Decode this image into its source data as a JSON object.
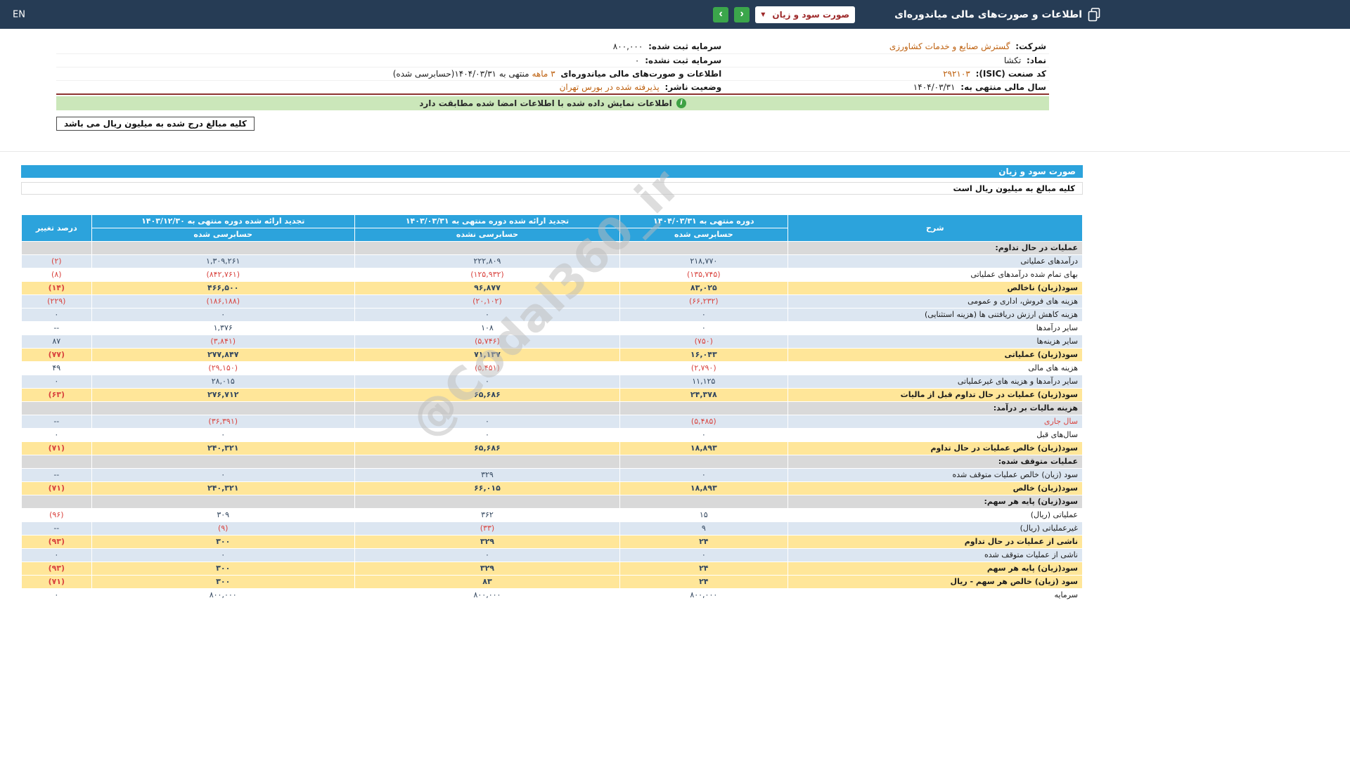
{
  "colors": {
    "topbar_navy": "#263C55",
    "accent_blue": "#2CA3DC",
    "row_blue": "#DCE6F1",
    "row_yellow": "#FFE699",
    "row_gray": "#D9D9D9",
    "negative_red": "#D9443F",
    "value_orange": "#BE6110",
    "banner_green": "#CBE7BA",
    "maroon": "#8C3330",
    "button_green": "#3BA64B"
  },
  "topbar": {
    "title": "اطلاعات و صورت‌های مالی میاندوره‌ای",
    "report_select_value": "صورت سود و زیان",
    "select_caret": "▼",
    "nav_forward": "‹",
    "nav_back": "›",
    "lang_link": "EN"
  },
  "company": {
    "rows": [
      {
        "r_label": "شرکت:",
        "r_value": "گسترش صنایع و خدمات کشاورزی",
        "r_class": "val orange",
        "l_label": "سرمایه ثبت شده:",
        "l_value": "۸۰۰,۰۰۰",
        "l_class": "val"
      },
      {
        "r_label": "نماد:",
        "r_value": "تکشا",
        "r_class": "val",
        "l_label": "سرمایه ثبت نشده:",
        "l_value": "۰",
        "l_class": "val"
      },
      {
        "r_label": "کد صنعت (ISIC):",
        "r_value": "۲۹۲۱۰۳",
        "r_class": "val orange",
        "l_label": "اطلاعات و صورت‌های مالی میاندوره‌ای",
        "l_value": "۳ ماهه",
        "l_class": "val orange",
        "l_suffix": "منتهی به ۱۴۰۴/۰۳/۳۱(حسابرسی شده)"
      },
      {
        "r_label": "سال مالی منتهی به:",
        "r_value": "۱۴۰۴/۰۳/۳۱",
        "r_class": "val",
        "l_label": "وضعیت ناشر:",
        "l_value": "پذیرفته شده در بورس تهران",
        "l_class": "val orange"
      }
    ],
    "signed_banner": "اطلاعات نمایش داده شده با اطلاعات امضا شده مطابقت دارد",
    "amounts_note": "کلیه مبالغ درج شده به میلیون ریال می باشد"
  },
  "statement": {
    "title": "صورت سود و زیان",
    "subtitle": "کلیه مبالغ به میلیون ریال است",
    "columns": {
      "desc": "شرح",
      "pct": "درصد تغییر",
      "periods": [
        {
          "title": "دوره منتهی به ۱۴۰۴/۰۳/۳۱",
          "sub": "حسابرسی شده"
        },
        {
          "title": "تجدید ارائه شده دوره منتهی به ۱۴۰۳/۰۳/۳۱",
          "sub": "حسابرسی نشده"
        },
        {
          "title": "تجدید ارائه شده دوره منتهی به ۱۴۰۳/۱۲/۳۰",
          "sub": "حسابرسی شده"
        }
      ]
    },
    "rows": [
      {
        "label": "عملیات در حال تداوم:",
        "bg": "gray"
      },
      {
        "label": "درآمدهای عملیاتی",
        "c1": "۲۱۸,۷۷۰",
        "c2": "۲۲۲,۸۰۹",
        "c3": "۱,۳۰۹,۲۶۱",
        "pct": "(۲)",
        "bg": "blue"
      },
      {
        "label": "بهای تمام شده درآمدهای عملیاتی",
        "c1": "(۱۳۵,۷۴۵)",
        "c2": "(۱۲۵,۹۳۲)",
        "c3": "(۸۴۲,۷۶۱)",
        "pct": "(۸)",
        "bg": "white"
      },
      {
        "label": "سود(زیان) ناخالص",
        "c1": "۸۳,۰۲۵",
        "c2": "۹۶,۸۷۷",
        "c3": "۴۶۶,۵۰۰",
        "pct": "(۱۴)",
        "bg": "yellow"
      },
      {
        "label": "هزینه های فروش، اداری و عمومی",
        "c1": "(۶۶,۲۳۲)",
        "c2": "(۲۰,۱۰۲)",
        "c3": "(۱۸۶,۱۸۸)",
        "pct": "(۲۲۹)",
        "bg": "blue"
      },
      {
        "label": "هزینه کاهش ارزش دریافتنی ها (هزینه استثنایی)",
        "c1": "۰",
        "c2": "۰",
        "c3": "۰",
        "pct": "۰",
        "bg": "blue"
      },
      {
        "label": "سایر درآمدها",
        "c1": "۰",
        "c2": "۱۰۸",
        "c3": "۱,۳۷۶",
        "pct": "--",
        "bg": "white"
      },
      {
        "label": "سایر هزینه‌ها",
        "c1": "(۷۵۰)",
        "c2": "(۵,۷۴۶)",
        "c3": "(۳,۸۴۱)",
        "pct": "۸۷",
        "bg": "blue"
      },
      {
        "label": "سود(زیان) عملیاتی",
        "c1": "۱۶,۰۴۳",
        "c2": "۷۱,۱۳۷",
        "c3": "۲۷۷,۸۴۷",
        "pct": "(۷۷)",
        "bg": "yellow"
      },
      {
        "label": "هزینه های مالی",
        "c1": "(۲,۷۹۰)",
        "c2": "(۵,۴۵۱)",
        "c3": "(۲۹,۱۵۰)",
        "pct": "۴۹",
        "bg": "white"
      },
      {
        "label": "سایر درآمدها و هزینه های غیرعملیاتی",
        "c1": "۱۱,۱۲۵",
        "c2": "۰",
        "c3": "۲۸,۰۱۵",
        "pct": "۰",
        "bg": "blue"
      },
      {
        "label": "سود(زیان) عملیات در حال تداوم قبل از مالیات",
        "c1": "۲۴,۳۷۸",
        "c2": "۶۵,۶۸۶",
        "c3": "۲۷۶,۷۱۲",
        "pct": "(۶۳)",
        "bg": "yellow"
      },
      {
        "label": "هزینه مالیات بر درآمد:",
        "bg": "gray"
      },
      {
        "label": "سال جاری",
        "c1": "(۵,۴۸۵)",
        "c2": "۰",
        "c3": "(۳۶,۳۹۱)",
        "pct": "--",
        "bg": "blue",
        "red": true
      },
      {
        "label": "سال‌های قبل",
        "c1": "۰",
        "c2": "۰",
        "c3": "۰",
        "pct": "۰",
        "bg": "white"
      },
      {
        "label": "سود(زیان) خالص عملیات در حال تداوم",
        "c1": "۱۸,۸۹۳",
        "c2": "۶۵,۶۸۶",
        "c3": "۲۴۰,۳۲۱",
        "pct": "(۷۱)",
        "bg": "yellow"
      },
      {
        "label": "عملیات متوقف شده:",
        "bg": "gray"
      },
      {
        "label": "سود (زیان) خالص عملیات متوقف شده",
        "c1": "۰",
        "c2": "۳۲۹",
        "c3": "۰",
        "pct": "--",
        "bg": "blue"
      },
      {
        "label": "سود(زیان) خالص",
        "c1": "۱۸,۸۹۳",
        "c2": "۶۶,۰۱۵",
        "c3": "۲۴۰,۳۲۱",
        "pct": "(۷۱)",
        "bg": "yellow"
      },
      {
        "label": "سود(زیان) پایه هر سهم:",
        "bg": "gray"
      },
      {
        "label": "عملیاتی (ریال)",
        "c1": "۱۵",
        "c2": "۳۶۲",
        "c3": "۳۰۹",
        "pct": "(۹۶)",
        "bg": "white"
      },
      {
        "label": "غیرعملیاتی (ریال)",
        "c1": "۹",
        "c2": "(۳۳)",
        "c3": "(۹)",
        "pct": "--",
        "bg": "blue"
      },
      {
        "label": "ناشی از عملیات در حال تداوم",
        "c1": "۲۴",
        "c2": "۳۲۹",
        "c3": "۳۰۰",
        "pct": "(۹۳)",
        "bg": "yellow"
      },
      {
        "label": "ناشی از عملیات متوقف شده",
        "c1": "۰",
        "c2": "۰",
        "c3": "۰",
        "pct": "۰",
        "bg": "blue"
      },
      {
        "label": "سود(زیان) پایه هر سهم",
        "c1": "۲۴",
        "c2": "۳۲۹",
        "c3": "۳۰۰",
        "pct": "(۹۳)",
        "bg": "yellow"
      },
      {
        "label": "سود (زیان) خالص هر سهم - ریال",
        "c1": "۲۴",
        "c2": "۸۳",
        "c3": "۳۰۰",
        "pct": "(۷۱)",
        "bg": "yellow"
      },
      {
        "label": "سرمایه",
        "c1": "۸۰۰,۰۰۰",
        "c2": "۸۰۰,۰۰۰",
        "c3": "۸۰۰,۰۰۰",
        "pct": "۰",
        "bg": "white"
      }
    ]
  },
  "watermark": "@Codal360_ir"
}
